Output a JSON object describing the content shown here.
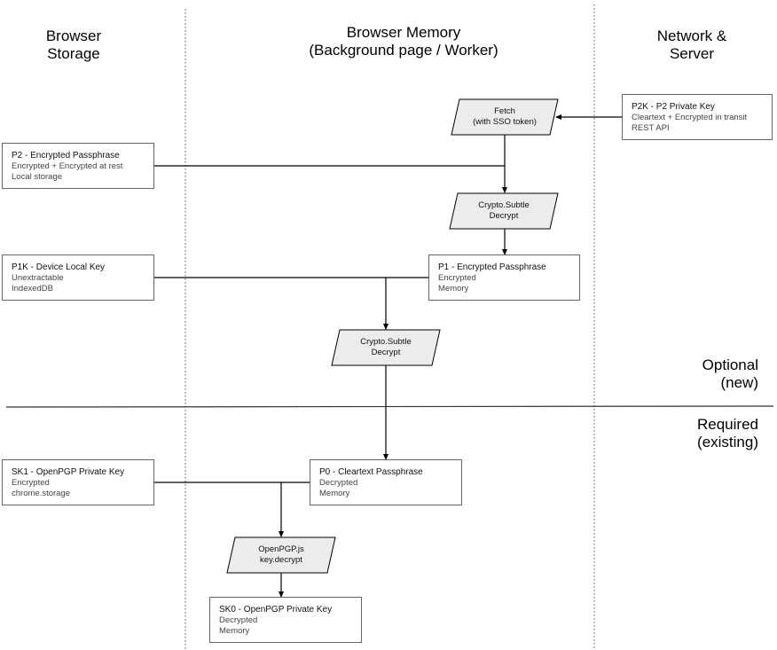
{
  "lanes": {
    "storage": "Browser\nStorage",
    "memory": "Browser Memory\n(Background page / Worker)",
    "network": "Network &\nServer"
  },
  "sections": {
    "optional": "Optional\n(new)",
    "required": "Required\n(existing)"
  },
  "nodes": {
    "p2k": {
      "title": "P2K - P2 Private Key",
      "lines": [
        "Cleartext + Encrypted in transit",
        "REST API"
      ]
    },
    "p2": {
      "title": "P2 - Encrypted Passphrase",
      "lines": [
        "Encrypted + Encrypted at rest",
        "Local storage"
      ]
    },
    "p1k": {
      "title": "P1K - Device Local Key",
      "lines": [
        "Unextractable",
        "IndexedDB"
      ]
    },
    "p1": {
      "title": "P1 - Encrypted Passphrase",
      "lines": [
        "Encrypted",
        "Memory"
      ]
    },
    "sk1": {
      "title": "SK1 - OpenPGP Private Key",
      "lines": [
        "Encrypted",
        "chrome.storage"
      ]
    },
    "p0": {
      "title": "P0 - Cleartext Passphrase",
      "lines": [
        "Decrypted",
        "Memory"
      ]
    },
    "sk0": {
      "title": "SK0 - OpenPGP Private Key",
      "lines": [
        "Decrypted",
        "Memory"
      ]
    }
  },
  "processes": {
    "fetch": "Fetch\n(with SSO token)",
    "decrypt1": "Crypto.Subtle\nDecrypt",
    "decrypt2": "Crypto.Subtle\nDecrypt",
    "openpgp": "OpenPGP.js\nkey.decrypt"
  },
  "colors": {
    "process_fill": "#ececec",
    "border": "#666666",
    "line": "#000000"
  }
}
